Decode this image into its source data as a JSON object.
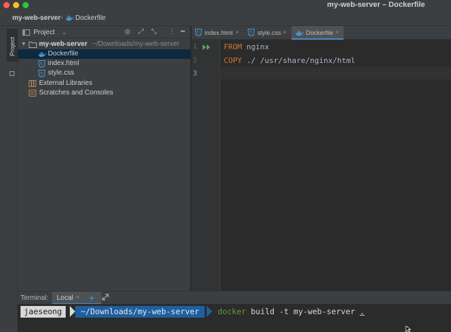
{
  "window": {
    "title": "my-web-server – Dockerfile"
  },
  "navbar": {
    "project": "my-web-server",
    "separator": "›",
    "file": "Dockerfile"
  },
  "toolstrip": {
    "project_label": "Project"
  },
  "project_panel": {
    "title": "Project",
    "tree": {
      "root": {
        "name": "my-web-server",
        "path": "~/Downloads/my-web-server"
      },
      "files": [
        "Dockerfile",
        "index.html",
        "style.css"
      ],
      "external_libraries": "External Libraries",
      "scratches": "Scratches and Consoles"
    }
  },
  "tabs": [
    {
      "label": "index.html",
      "close": "×"
    },
    {
      "label": "style.css",
      "close": "×"
    },
    {
      "label": "Dockerfile",
      "close": "×"
    }
  ],
  "editor": {
    "line_numbers": [
      "1",
      "2",
      "3"
    ],
    "lines": [
      {
        "keyword": "FROM",
        "args": " nginx"
      },
      {
        "keyword": "COPY",
        "args": " ./ /usr/share/nginx/html"
      },
      {
        "keyword": "",
        "args": ""
      }
    ]
  },
  "terminal": {
    "title": "Terminal:",
    "tab": "Local",
    "tab_close": "×",
    "add": "+",
    "prompt_user": "jaeseong",
    "prompt_path": "~/Downloads/my-web-server",
    "command_name": "docker",
    "command_args": " build -t my-web-server ",
    "command_last": "."
  },
  "colors": {
    "keyword": "#cc7832",
    "selection": "#0d293e",
    "path_segment": "#1f5fa0",
    "command": "#6a9a3d"
  }
}
